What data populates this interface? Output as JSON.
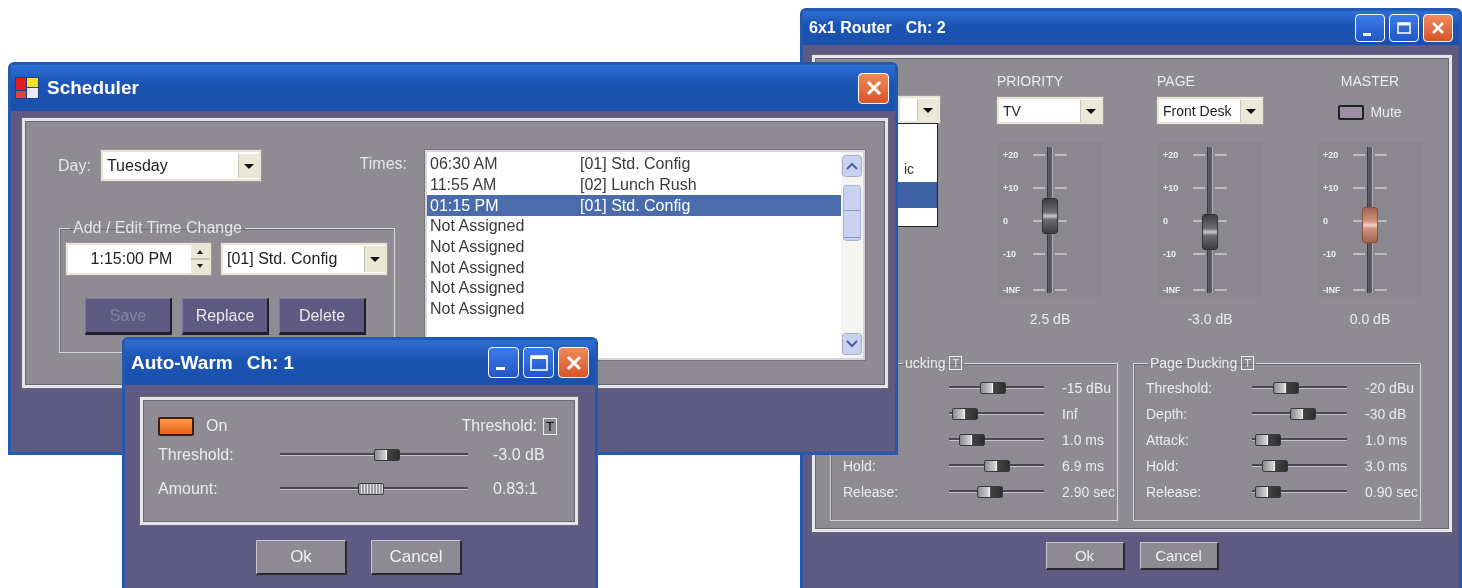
{
  "router": {
    "title": "6x1 Router",
    "channel": "Ch: 2",
    "source_list": {
      "items": [
        {
          "label": "ic",
          "selected": false
        },
        {
          "selected": true
        }
      ]
    },
    "columns": [
      {
        "kind": "select",
        "heading": "PRIORITY",
        "value": "TV",
        "scale": [
          "+20",
          "+10",
          "0",
          "-10",
          "-INF"
        ],
        "level": 0.56,
        "reading": "2.5 dB"
      },
      {
        "kind": "select",
        "heading": "PAGE",
        "value": "Front Desk",
        "scale": [
          "+20",
          "+10",
          "0",
          "-10",
          "-INF"
        ],
        "level": 0.45,
        "reading": "-3.0 dB"
      },
      {
        "kind": "mute",
        "heading": "MASTER",
        "mute": {
          "label": "Mute",
          "on": false
        },
        "scale": [
          "+20",
          "+10",
          "0",
          "-10",
          "-INF"
        ],
        "level": 0.5,
        "reading": "0.0 dB"
      }
    ],
    "ducking": [
      {
        "title": "ucking",
        "toggle": "T",
        "rows": [
          {
            "level": 0.45,
            "value": "-15 dBu"
          },
          {
            "level": 0.05,
            "value": "Inf"
          },
          {
            "level": 0.15,
            "value": "1.0 ms"
          },
          {
            "label": "Hold:",
            "level": 0.5,
            "value": "6.9 ms"
          },
          {
            "label": "Release:",
            "level": 0.4,
            "value": "2.90 sec"
          }
        ]
      },
      {
        "title": "Page Ducking",
        "toggle": "T",
        "rows": [
          {
            "label": "Threshold:",
            "level": 0.3,
            "value": "-20 dBu"
          },
          {
            "label": "Depth:",
            "level": 0.55,
            "value": "-30 dB"
          },
          {
            "label": "Attack:",
            "level": 0.05,
            "value": "1.0 ms"
          },
          {
            "label": "Hold:",
            "level": 0.15,
            "value": "3.0 ms"
          },
          {
            "label": "Release:",
            "level": 0.05,
            "value": "0.90 sec"
          }
        ]
      }
    ],
    "buttons": [
      "Ok",
      "Cancel"
    ]
  },
  "scheduler": {
    "title": "Scheduler",
    "day": {
      "label": "Day:",
      "value": "Tuesday"
    },
    "times_label": "Times:",
    "times": [
      {
        "time": "06:30 AM",
        "config": "[01] Std. Config",
        "selected": false
      },
      {
        "time": "11:55 AM",
        "config": "[02] Lunch Rush",
        "selected": false
      },
      {
        "time": "01:15 PM",
        "config": "[01] Std. Config",
        "selected": true
      },
      {
        "time": "Not Assigned",
        "selected": false
      },
      {
        "time": "Not Assigned",
        "selected": false
      },
      {
        "time": "Not Assigned",
        "selected": false
      },
      {
        "time": "Not Assigned",
        "selected": false
      },
      {
        "time": "Not Assigned",
        "selected": false
      }
    ],
    "edit_group": {
      "title": "Add / Edit Time Change",
      "time": "1:15:00 PM",
      "config": "[01] Std. Config"
    },
    "buttons": [
      {
        "label": "Save",
        "disabled": true
      },
      {
        "label": "Replace",
        "disabled": false
      },
      {
        "label": "Delete",
        "disabled": false
      }
    ]
  },
  "auto_warm": {
    "title": "Auto-Warm",
    "channel": "Ch: 1",
    "enable": {
      "label": "On",
      "on": true
    },
    "threshold_label": "Threshold:",
    "toggle": "T",
    "sliders": [
      {
        "label": "Threshold:",
        "level": 0.58,
        "value": "-3.0 dB"
      },
      {
        "label": "Amount:",
        "level": 0.48,
        "value": "0.83:1"
      }
    ],
    "buttons": [
      "Ok",
      "Cancel"
    ]
  }
}
